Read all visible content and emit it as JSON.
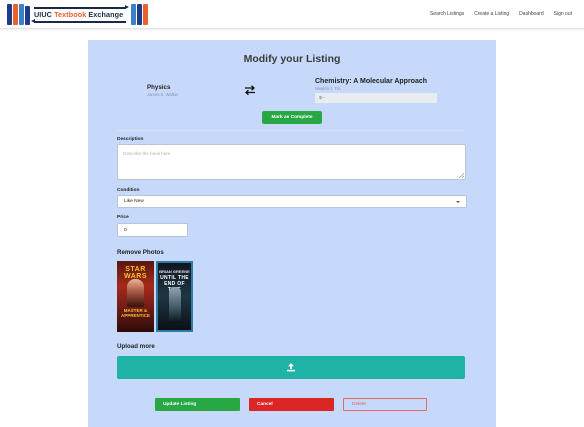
{
  "brand": {
    "name_part1": "UIUC",
    "name_part2": "Textbook",
    "name_part3": "Exchange"
  },
  "nav": {
    "links": [
      "Search Listings",
      "Create a Listing",
      "Dashboard",
      "Sign out"
    ]
  },
  "form": {
    "title": "Modify your Listing",
    "offered_book": {
      "title": "Physics",
      "author": "James S. Walker"
    },
    "requested_book": {
      "title": "Chemistry: A Molecular Approach",
      "author": "Nivaldo J. Tro"
    },
    "requested_price_placeholder": "$--",
    "mark_complete_label": "Mark as Complete",
    "description_label": "Description",
    "description_placeholder": "Describe the book here",
    "condition_label": "Condition",
    "condition_value": "Like New",
    "price_label": "Price",
    "price_value": "0",
    "remove_photos_label": "Remove Photos",
    "photos": [
      {
        "line1": "STAR WARS",
        "line2": "MASTER & APPRENTICE"
      },
      {
        "line1": "BRIAN GREENE",
        "line2": "UNTIL THE END OF TIME"
      }
    ],
    "upload_more_label": "Upload more",
    "buttons": {
      "update": "Update Listing",
      "cancel": "Cancel",
      "delete": "Delete"
    }
  },
  "colors": {
    "panel_bg": "#c6d9fb",
    "success": "#28a745",
    "danger": "#dc2626",
    "teal": "#1fb3a6",
    "brand_accent": "#e8622c"
  },
  "icons": [
    "logo-books-icon",
    "swap-arrows-icon",
    "upload-icon",
    "chevron-down-icon"
  ]
}
